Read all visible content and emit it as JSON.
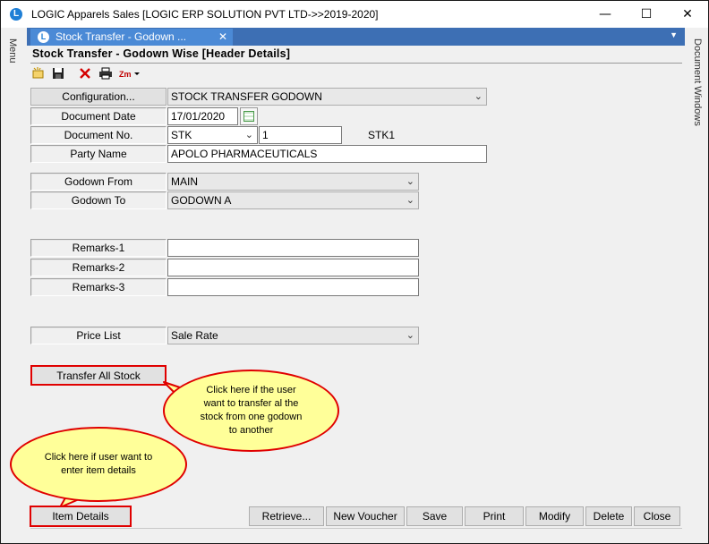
{
  "window": {
    "title": "LOGIC Apparels Sales  [LOGIC ERP SOLUTION PVT LTD->>2019-2020]",
    "minimize_glyph": "—",
    "maximize_glyph": "☐",
    "close_glyph": "✕"
  },
  "side": {
    "left_label": "Menu",
    "right_label": "Document Windows"
  },
  "tab": {
    "label": "Stock Transfer - Godown ...",
    "close_glyph": "✕"
  },
  "form": {
    "title": "Stock Transfer - Godown Wise [Header Details]",
    "fields": {
      "configuration": {
        "label": "Configuration...",
        "value": "STOCK TRANSFER GODOWN"
      },
      "document_date": {
        "label": "Document Date",
        "value": "17/01/2020"
      },
      "document_no": {
        "label": "Document No.",
        "series": "STK",
        "number": "1",
        "code": "STK1"
      },
      "party_name": {
        "label": "Party Name",
        "value": "APOLO PHARMACEUTICALS"
      },
      "godown_from": {
        "label": "Godown From",
        "value": "MAIN"
      },
      "godown_to": {
        "label": "Godown To",
        "value": "GODOWN A"
      },
      "remarks1": {
        "label": "Remarks-1",
        "value": ""
      },
      "remarks2": {
        "label": "Remarks-2",
        "value": ""
      },
      "remarks3": {
        "label": "Remarks-3",
        "value": ""
      },
      "price_list": {
        "label": "Price List",
        "value": "Sale Rate"
      }
    },
    "transfer_all_stock": "Transfer All Stock",
    "callouts": {
      "transfer": "Click  here  if  the  user want  to  transfer  al  the stock  from  one  godown to  another",
      "item_details": "Click  here  if  user  want to  enter  item  details"
    },
    "buttons": {
      "item_details": "Item Details",
      "retrieve": "Retrieve...",
      "new_voucher": "New Voucher",
      "save": "Save",
      "print": "Print",
      "modify": "Modify",
      "delete": "Delete",
      "close": "Close"
    }
  },
  "icons": [
    "app-logo-icon",
    "new-icon",
    "save-icon",
    "delete-icon",
    "print-icon",
    "zoom-icon"
  ],
  "colors": {
    "tab_bar": "#3d6fb4",
    "tab": "#4b8ad6",
    "callout_fill": "#ffff99",
    "highlight": "#e00000"
  }
}
